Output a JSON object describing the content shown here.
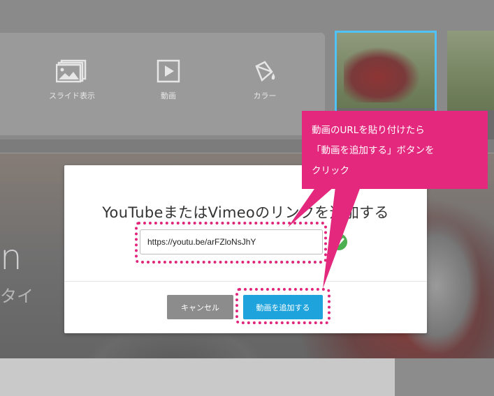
{
  "toolbar": {
    "items": [
      {
        "label": "スライド表示",
        "icon": "slides-icon"
      },
      {
        "label": "動画",
        "icon": "video-play-icon"
      },
      {
        "label": "カラー",
        "icon": "paint-bucket-icon"
      }
    ]
  },
  "hero": {
    "text_big": "n",
    "text_small": "タイ"
  },
  "modal": {
    "title": "YouTubeまたはVimeoのリンクを追加する",
    "url_input": {
      "value": "https://youtu.be/arFZloNsJhY"
    },
    "cancel_label": "キャンセル",
    "add_label": "動画を追加する"
  },
  "callout": {
    "line1": "動画のURLを貼り付けたら",
    "line2": "「動画を追加する」ボタンを",
    "line3": "クリック"
  },
  "colors": {
    "accent_blue": "#1fa3dc",
    "annotation_pink": "#e3287e",
    "check_green": "#4caf50"
  }
}
